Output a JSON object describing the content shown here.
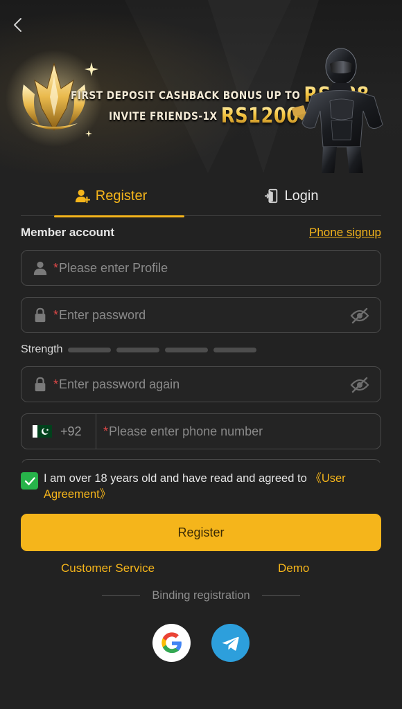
{
  "banner": {
    "line1_text": "FIRST DEPOSIT CASHBACK BONUS UP TO",
    "line1_amount": "RS188",
    "line2_text": "INVITE FRIENDS-1X",
    "line2_amount": "RS1200"
  },
  "tabs": [
    {
      "label": "Register",
      "active": true,
      "icon": "user-plus-icon"
    },
    {
      "label": "Login",
      "active": false,
      "icon": "login-door-icon"
    }
  ],
  "form": {
    "section_label": "Member account",
    "phone_signup": "Phone signup",
    "required_marker": "*",
    "profile_placeholder": "Please enter Profile",
    "password_placeholder": "Enter password",
    "password_again_placeholder": "Enter password again",
    "strength_label": "Strength",
    "country_code": "+92",
    "phone_placeholder": "Please enter phone number"
  },
  "agreement": {
    "checked": true,
    "text": "I am over 18 years old and have read and agreed to",
    "link": "《User Agreement》"
  },
  "actions": {
    "register": "Register",
    "customer_service": "Customer Service",
    "demo": "Demo"
  },
  "binding": {
    "label": "Binding registration",
    "providers": [
      "google-icon",
      "telegram-icon"
    ]
  },
  "colors": {
    "accent": "#f5b51b",
    "background": "#222222",
    "check": "#27b34a",
    "required": "#e04848",
    "telegram": "#2d9fdc"
  }
}
